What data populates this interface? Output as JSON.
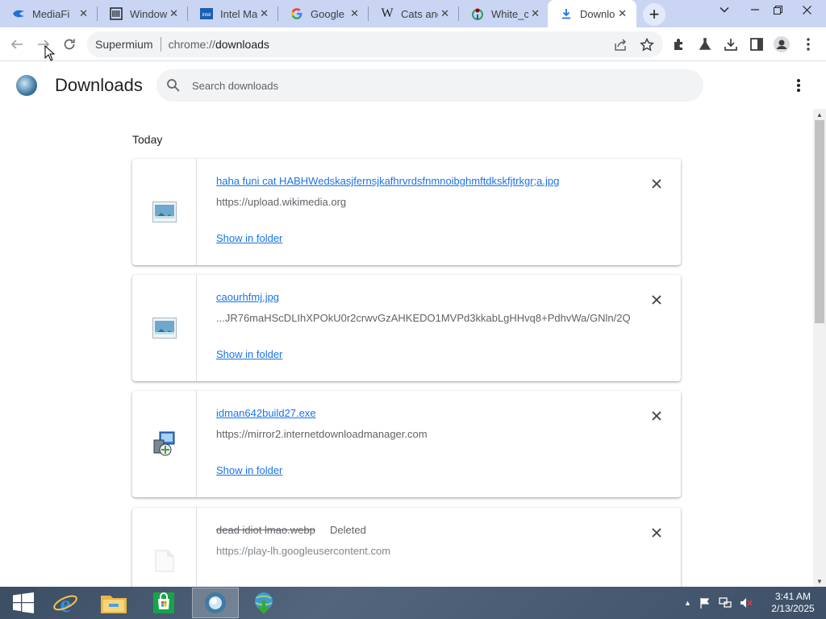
{
  "tabs": [
    {
      "title": "MediaFire",
      "icon": "mediafire-icon"
    },
    {
      "title": "Windows",
      "icon": "windows-archive-icon"
    },
    {
      "title": "Intel Ma",
      "icon": "intel-icon"
    },
    {
      "title": "Google",
      "icon": "google-icon"
    },
    {
      "title": "Cats and",
      "icon": "wikipedia-icon"
    },
    {
      "title": "White_c",
      "icon": "wikimedia-icon"
    },
    {
      "title": "Downlo",
      "icon": "download-icon"
    }
  ],
  "toolbar": {
    "origin_label": "Supermium",
    "url_scheme": "chrome://",
    "url_path": "downloads"
  },
  "page": {
    "title": "Downloads",
    "search_placeholder": "Search downloads",
    "date_group": "Today"
  },
  "downloads": [
    {
      "filename": "haha funi cat HABHWedskasjfernsjkafhrvrdsfnmnoibghmftdkskfjtrkgr;a.jpg",
      "source": "https://upload.wikimedia.org",
      "action": "Show in folder",
      "icon": "image-file-icon",
      "status": ""
    },
    {
      "filename": "caourhfmj.jpg",
      "source": "...JR76maHScDLIhXPOkU0r2crwvGzAHKEDO1MVPd3kkabLgHHvq8+PdhvWa/GNln/2Q",
      "action": "Show in folder",
      "icon": "image-file-icon",
      "status": ""
    },
    {
      "filename": "idman642build27.exe",
      "source": "https://mirror2.internetdownloadmanager.com",
      "action": "Show in folder",
      "icon": "installer-icon",
      "status": ""
    },
    {
      "filename": "dead idiot lmao.webp",
      "source": "https://play-lh.googleusercontent.com",
      "action": "",
      "icon": "blank-file-icon",
      "status": "Deleted"
    }
  ],
  "taskbar": {
    "time": "3:41 AM",
    "date": "2/13/2025",
    "apps": [
      "start-button",
      "internet-explorer-icon",
      "file-explorer-icon",
      "store-icon",
      "supermium-icon",
      "internet-download-manager-icon"
    ]
  },
  "colors": {
    "tabstrip": "#c9d5f3",
    "link": "#1a73e8",
    "text_secondary": "#5f6368"
  }
}
